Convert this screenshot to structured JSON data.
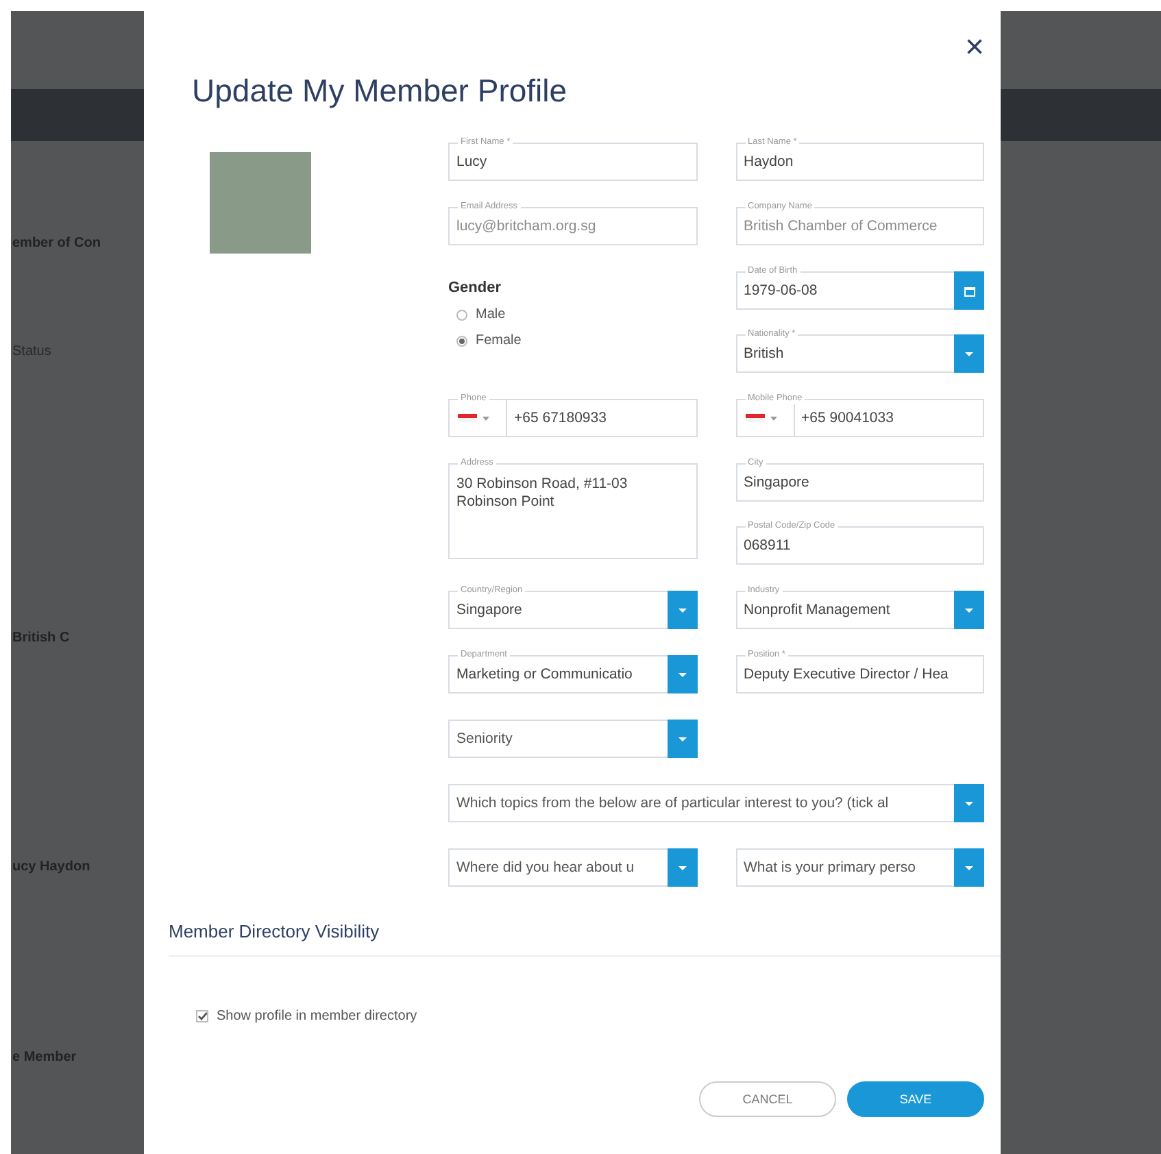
{
  "backdrop": {
    "left_texts": [
      {
        "text": "ember of Con",
        "kind": "heading"
      },
      {
        "text": "Status",
        "kind": "label"
      },
      {
        "text": "British C",
        "kind": "heading"
      },
      {
        "text": "ucy Haydon",
        "kind": "heading"
      },
      {
        "text": "e Member",
        "kind": "heading"
      }
    ]
  },
  "dialog": {
    "title": "Update My Member Profile",
    "close": "×",
    "rows": [
      {
        "left": [
          {
            "kind": "text",
            "label": "First Name *",
            "value": "Lucy",
            "disabled": false
          }
        ],
        "right": [
          {
            "kind": "text",
            "label": "Last Name *",
            "value": "Haydon",
            "disabled": false
          }
        ]
      },
      {
        "left": [
          {
            "kind": "text",
            "label": "Email Address",
            "value": "lucy@britcham.org.sg",
            "disabled": true
          }
        ],
        "right": [
          {
            "kind": "text",
            "label": "Company Name",
            "value": "British Chamber of Commerce",
            "disabled": true
          }
        ]
      },
      {
        "left": [
          {
            "kind": "radio_group",
            "label": "Gender",
            "options": [
              {
                "label": "Male",
                "selected": false
              },
              {
                "label": "Female",
                "selected": true
              }
            ]
          }
        ],
        "right": [
          {
            "kind": "date",
            "label": "Date of Birth",
            "value": "1979-06-08"
          },
          {
            "kind": "select",
            "label": "Nationality *",
            "value": "British"
          }
        ]
      },
      {
        "left": [
          {
            "kind": "phone",
            "label": "Phone",
            "value": "+65 67180933"
          }
        ],
        "right": [
          {
            "kind": "phone",
            "label": "Mobile Phone",
            "value": "+65 90041033"
          }
        ]
      },
      {
        "left": [
          {
            "kind": "textarea",
            "label": "Address",
            "value": "30 Robinson Road, #11-03 Robinson Point"
          }
        ],
        "right": [
          {
            "kind": "text",
            "label": "City",
            "value": "Singapore",
            "disabled": false
          },
          {
            "kind": "text",
            "label": "Postal Code/Zip Code",
            "value": "068911",
            "disabled": false
          }
        ]
      },
      {
        "left": [
          {
            "kind": "select",
            "label": "Country/Region",
            "value": "Singapore"
          }
        ],
        "right": [
          {
            "kind": "select",
            "label": "Industry",
            "value": "Nonprofit Management"
          }
        ]
      },
      {
        "left": [
          {
            "kind": "select",
            "label": "Department",
            "value": "Marketing or Communicatio"
          }
        ],
        "right": [
          {
            "kind": "text",
            "label": "Position *",
            "value": "Deputy Executive Director / Hea",
            "disabled": false
          }
        ]
      },
      {
        "left": [
          {
            "kind": "select",
            "placeholder": "Seniority"
          }
        ],
        "right": []
      },
      {
        "full": [
          {
            "kind": "select",
            "placeholder": "Which topics from the below are of particular interest to you? (tick al"
          }
        ]
      },
      {
        "left": [
          {
            "kind": "select",
            "placeholder": "Where did you hear about u"
          }
        ],
        "right": [
          {
            "kind": "select",
            "placeholder": "What is your primary perso"
          }
        ]
      }
    ],
    "visibility": {
      "heading": "Member Directory Visibility",
      "checkbox": {
        "label": "Show profile in member directory",
        "checked": true
      }
    },
    "buttons": [
      {
        "label": "CANCEL",
        "kind": "secondary"
      },
      {
        "label": "SAVE",
        "kind": "primary"
      }
    ]
  }
}
